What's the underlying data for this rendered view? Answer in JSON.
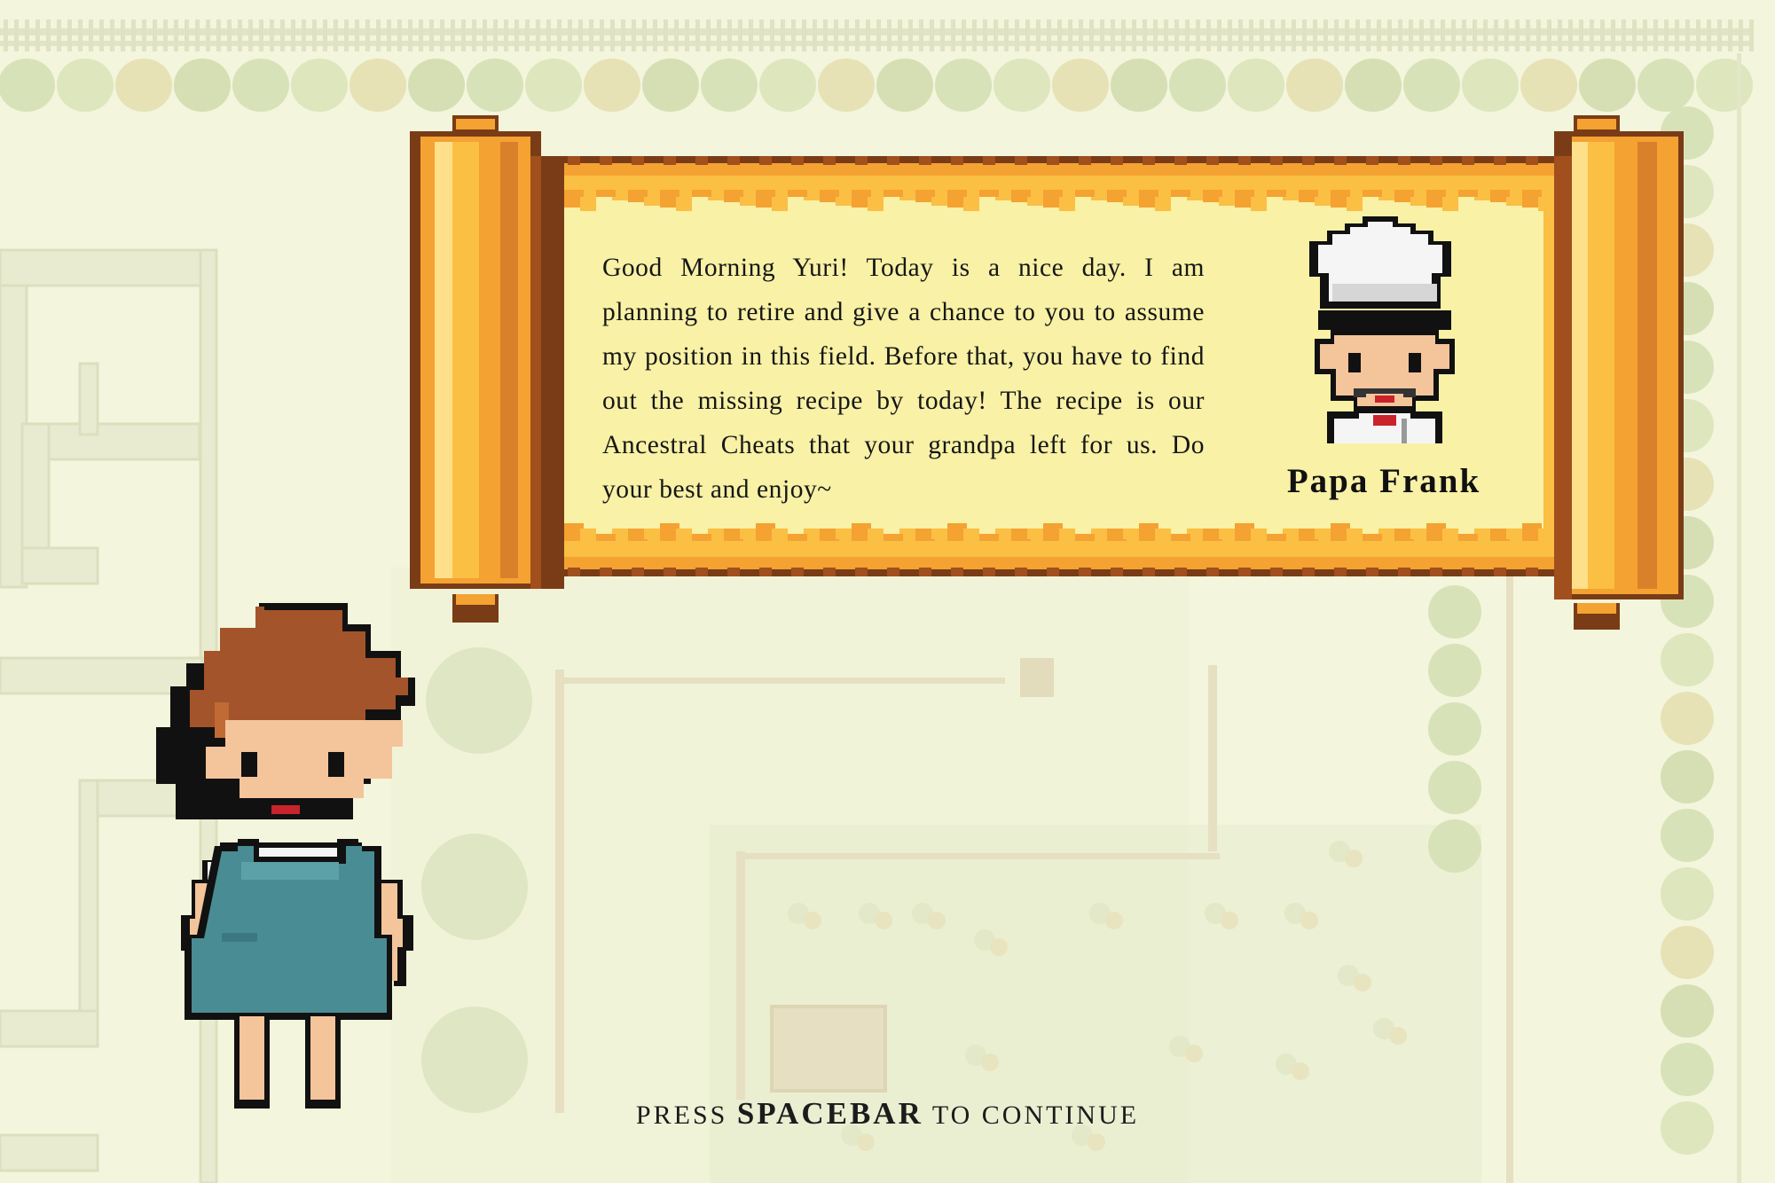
{
  "dialog": {
    "message": "Good Morning Yuri! Today is a nice day. I am planning to retire and give a chance to you to assume my position in this field. Before that, you have to find out the missing recipe by today! The recipe is our Ancestral Cheats that your grandpa left for us. Do your best and enjoy~",
    "speaker": "Papa Frank",
    "speaker_icon": "chef-portrait-icon"
  },
  "player": {
    "icon": "girl-character-icon"
  },
  "prompt": {
    "before": "PRESS ",
    "key": "SPACEBAR",
    "after": " TO CONTINUE"
  },
  "colors": {
    "background": "#f3f5dc",
    "scroll_gold": "#f4a232",
    "scroll_dark": "#7a3c16",
    "parchment": "#f8f1a6",
    "text": "#161616"
  }
}
